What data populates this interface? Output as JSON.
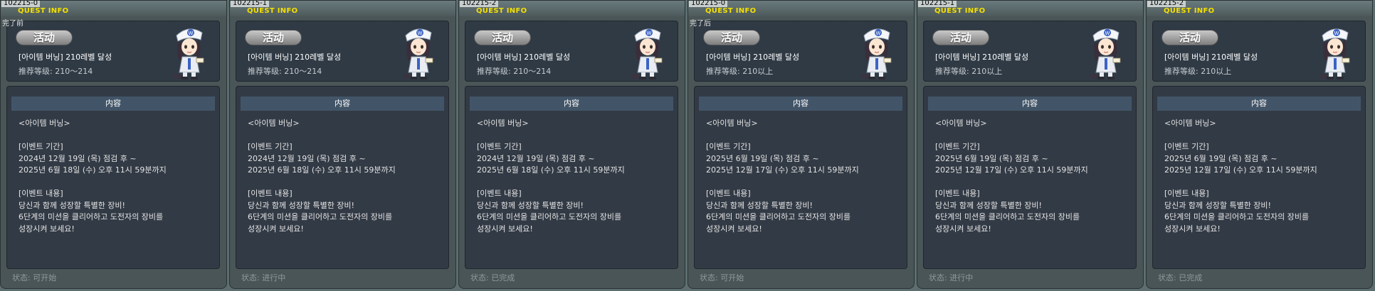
{
  "panels": [
    {
      "id_label": "102215-0",
      "header_title": "QUEST INFO",
      "top_label": "完了前",
      "badge": "活动",
      "quest_name": "[아이템 버닝] 210레벨 달성",
      "recommended_level": "推荐等级: 210～214",
      "content_header": "内容",
      "content_text": "<아이템 버닝>\n\n[이벤트 기간]\n2024년 12월 19일 (목) 점검 후 ~\n2025년 6월 18일 (수) 오후 11시 59분까지\n\n[이벤트 내용]\n당신과 함께 성장할 특별한 장비!\n6단계의 미션을 클리어하고 도전자의 장비를\n성장시켜 보세요!",
      "status": "状态:  可开始"
    },
    {
      "id_label": "102215-1",
      "header_title": "QUEST INFO",
      "top_label": "",
      "badge": "活动",
      "quest_name": "[아이템 버닝] 210레벨 달성",
      "recommended_level": "推荐等级: 210～214",
      "content_header": "内容",
      "content_text": "<아이템 버닝>\n\n[이벤트 기간]\n2024년 12월 19일 (목) 점검 후 ~\n2025년 6월 18일 (수) 오후 11시 59분까지\n\n[이벤트 내용]\n당신과 함께 성장할 특별한 장비!\n6단계의 미션을 클리어하고 도전자의 장비를\n성장시켜 보세요!",
      "status": "状态:  进行中"
    },
    {
      "id_label": "102215-2",
      "header_title": "QUEST INFO",
      "top_label": "",
      "badge": "活动",
      "quest_name": "[아이템 버닝] 210레벨 달성",
      "recommended_level": "推荐等级: 210～214",
      "content_header": "内容",
      "content_text": "<아이템 버닝>\n\n[이벤트 기간]\n2024년 12월 19일 (목) 점검 후 ~\n2025년 6월 18일 (수) 오후 11시 59분까지\n\n[이벤트 내용]\n당신과 함께 성장할 특별한 장비!\n6단계의 미션을 클리어하고 도전자의 장비를\n성장시켜 보세요!",
      "status": "状态:  已完成"
    },
    {
      "id_label": "102215-0",
      "header_title": "QUEST INFO",
      "top_label": "完了后",
      "badge": "活动",
      "quest_name": "[아이템 버닝] 210레벨 달성",
      "recommended_level": "推荐等级: 210以上",
      "content_header": "内容",
      "content_text": "<아이템 버닝>\n\n[이벤트 기간]\n2025년 6월 19일 (목) 점검 후 ~\n2025년 12월 17일 (수) 오후 11시 59분까지\n\n[이벤트 내용]\n당신과 함께 성장할 특별한 장비!\n6단계의 미션을 클리어하고 도전자의 장비를\n성장시켜 보세요!",
      "status": "状态:  可开始"
    },
    {
      "id_label": "102215-1",
      "header_title": "QUEST INFO",
      "top_label": "",
      "badge": "活动",
      "quest_name": "[아이템 버닝] 210레벨 달성",
      "recommended_level": "推荐等级: 210以上",
      "content_header": "内容",
      "content_text": "<아이템 버닝>\n\n[이벤트 기간]\n2025년 6월 19일 (목) 점검 후 ~\n2025년 12월 17일 (수) 오후 11시 59분까지\n\n[이벤트 내용]\n당신과 함께 성장할 특별한 장비!\n6단계의 미션을 클리어하고 도전자의 장비를\n성장시켜 보세요!",
      "status": "状态:  进行中"
    },
    {
      "id_label": "102215-2",
      "header_title": "QUEST INFO",
      "top_label": "",
      "badge": "活动",
      "quest_name": "[아이템 버닝] 210레벨 달성",
      "recommended_level": "推荐等级: 210以上",
      "content_header": "内容",
      "content_text": "<아이템 버닝>\n\n[이벤트 기간]\n2025년 6월 19일 (목) 점검 후 ~\n2025년 12월 17일 (수) 오후 11시 59분까지\n\n[이벤트 내용]\n당신과 함께 성장할 특별한 장비!\n6단계의 미션을 클리어하고 도전자의 장비를\n성장시켜 보세요!",
      "status": "状态:  已完成"
    }
  ]
}
